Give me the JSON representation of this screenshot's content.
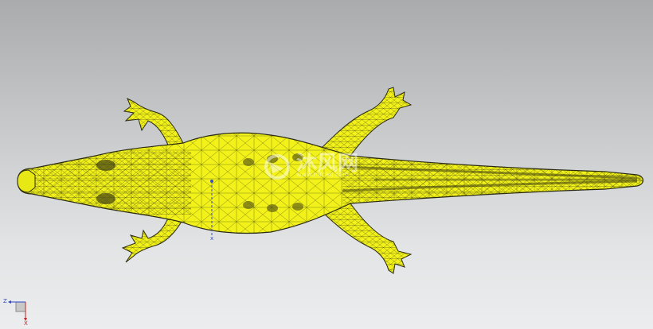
{
  "viewport": {
    "background_top": "#a9abad",
    "background_bottom": "#ecedee"
  },
  "model": {
    "icon": "crocodile-wireframe-mesh",
    "fill_color": "#f2f21a",
    "mesh_line_color": "#2a2a10"
  },
  "center_marker": {
    "axis_label": "x",
    "color": "#3a4cc8"
  },
  "watermark": {
    "text": "沐风网",
    "url": "www.mfcad.com",
    "icon": "watermark-logo-icon"
  },
  "triad": {
    "z_label": "Z",
    "x_label": "X",
    "z_color": "#2d48c8",
    "x_color": "#d02020"
  }
}
